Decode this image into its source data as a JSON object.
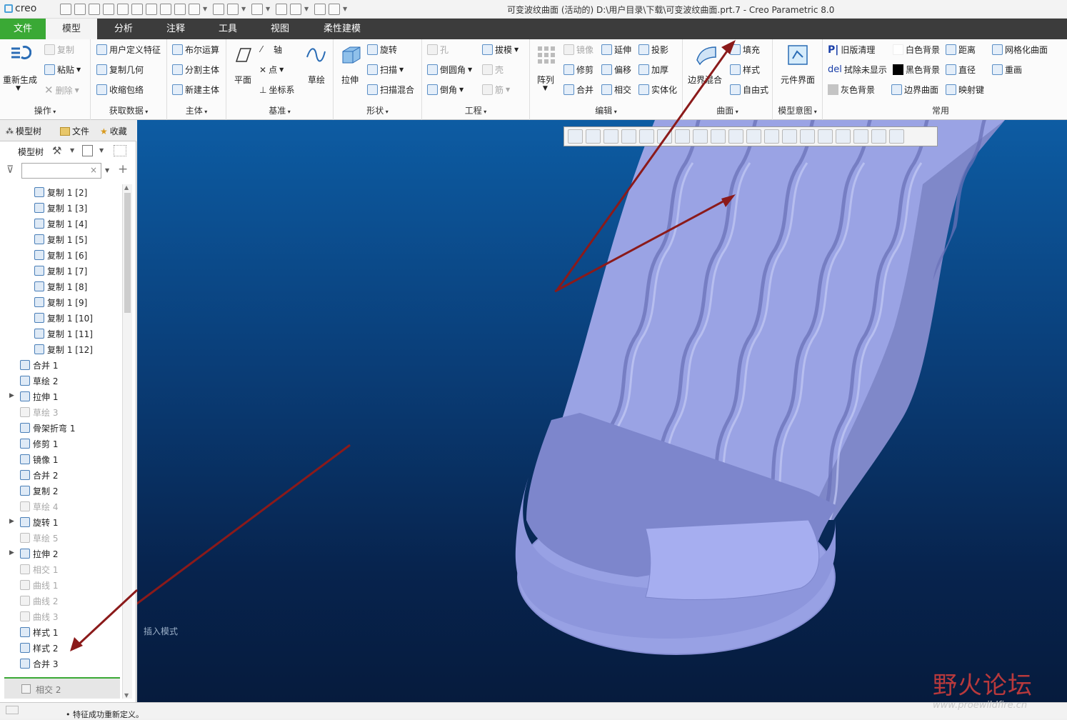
{
  "app": {
    "logo": "creo",
    "window_title": "可变波纹曲面 (活动的) D:\\用户目录\\下载\\可变波纹曲面.prt.7 - Creo Parametric 8.0"
  },
  "tabs": [
    "文件",
    "模型",
    "分析",
    "注释",
    "工具",
    "视图",
    "柔性建模"
  ],
  "ribbon": {
    "ops": {
      "label": "操作",
      "regen": "重新生成",
      "copy": "复制",
      "paste": "粘贴",
      "delete": "删除"
    },
    "getdata": {
      "label": "获取数据",
      "udf": "用户定义特征",
      "copygeom": "复制几何",
      "shrink": "收缩包络"
    },
    "body": {
      "label": "主体",
      "boolean": "布尔运算",
      "split": "分割主体",
      "newbody": "新建主体"
    },
    "datum": {
      "label": "基准",
      "plane": "平面",
      "axis": "轴",
      "point": "点",
      "csys": "坐标系",
      "sketch": "草绘"
    },
    "shape": {
      "label": "形状",
      "extrude": "拉伸",
      "revolve": "旋转",
      "sweep": "扫描",
      "sweepblend": "扫描混合"
    },
    "eng": {
      "label": "工程",
      "hole": "孔",
      "draft": "拔模",
      "round": "倒圆角",
      "shell": "壳",
      "chamfer": "倒角",
      "rib": "筋"
    },
    "edit": {
      "label": "编辑",
      "pattern": "阵列",
      "mirror": "镜像",
      "extend": "延伸",
      "project": "投影",
      "trim": "修剪",
      "offset": "偏移",
      "thicken": "加厚",
      "merge": "合并",
      "intersect": "相交",
      "solidify": "实体化"
    },
    "surf": {
      "label": "曲面",
      "boundary": "边界混合",
      "fill": "填充",
      "style": "样式",
      "freestyle": "自由式"
    },
    "intent": {
      "label": "模型意图",
      "comp": "元件界面"
    },
    "common": {
      "label": "常用",
      "oldclean": "旧版清理",
      "whitebg": "白色背景",
      "dist": "距离",
      "mesh": "网格化曲面",
      "erase": "拭除未显示",
      "blackbg": "黑色背景",
      "diam": "直径",
      "repaint": "重画",
      "greybg": "灰色背景",
      "bndsurf": "边界曲面",
      "mapkey": "映射键"
    }
  },
  "panel": {
    "tabs": [
      "模型树",
      "文件",
      "收藏"
    ],
    "tree_label": "模型树",
    "search_placeholder": ""
  },
  "tree": [
    {
      "label": "复制 1 [2]",
      "state": "active",
      "indent": 2,
      "expand": false
    },
    {
      "label": "复制 1 [3]",
      "state": "active",
      "indent": 2,
      "expand": false
    },
    {
      "label": "复制 1 [4]",
      "state": "active",
      "indent": 2,
      "expand": false
    },
    {
      "label": "复制 1 [5]",
      "state": "active",
      "indent": 2,
      "expand": false
    },
    {
      "label": "复制 1 [6]",
      "state": "active",
      "indent": 2,
      "expand": false
    },
    {
      "label": "复制 1 [7]",
      "state": "active",
      "indent": 2,
      "expand": false
    },
    {
      "label": "复制 1 [8]",
      "state": "active",
      "indent": 2,
      "expand": false
    },
    {
      "label": "复制 1 [9]",
      "state": "active",
      "indent": 2,
      "expand": false
    },
    {
      "label": "复制 1 [10]",
      "state": "active",
      "indent": 2,
      "expand": false
    },
    {
      "label": "复制 1 [11]",
      "state": "active",
      "indent": 2,
      "expand": false
    },
    {
      "label": "复制 1 [12]",
      "state": "active",
      "indent": 2,
      "expand": false
    },
    {
      "label": "合并 1",
      "state": "active",
      "indent": 1,
      "expand": false
    },
    {
      "label": "草绘 2",
      "state": "active",
      "indent": 1,
      "expand": false
    },
    {
      "label": "拉伸 1",
      "state": "active",
      "indent": 1,
      "expand": true
    },
    {
      "label": "草绘 3",
      "state": "suppressed",
      "indent": 1,
      "expand": false
    },
    {
      "label": "骨架折弯 1",
      "state": "active",
      "indent": 1,
      "expand": false
    },
    {
      "label": "修剪 1",
      "state": "active",
      "indent": 1,
      "expand": false
    },
    {
      "label": "镜像 1",
      "state": "active",
      "indent": 1,
      "expand": false
    },
    {
      "label": "合并 2",
      "state": "active",
      "indent": 1,
      "expand": false
    },
    {
      "label": "复制 2",
      "state": "active",
      "indent": 1,
      "expand": false
    },
    {
      "label": "草绘 4",
      "state": "suppressed",
      "indent": 1,
      "expand": false
    },
    {
      "label": "旋转 1",
      "state": "active",
      "indent": 1,
      "expand": true
    },
    {
      "label": "草绘 5",
      "state": "suppressed",
      "indent": 1,
      "expand": false
    },
    {
      "label": "拉伸 2",
      "state": "active",
      "indent": 1,
      "expand": true
    },
    {
      "label": "相交 1",
      "state": "suppressed",
      "indent": 1,
      "expand": false
    },
    {
      "label": "曲线 1",
      "state": "suppressed",
      "indent": 1,
      "expand": false
    },
    {
      "label": "曲线 2",
      "state": "suppressed",
      "indent": 1,
      "expand": false
    },
    {
      "label": "曲线 3",
      "state": "suppressed",
      "indent": 1,
      "expand": false
    },
    {
      "label": "样式 1",
      "state": "active",
      "indent": 1,
      "expand": false
    },
    {
      "label": "样式 2",
      "state": "active",
      "indent": 1,
      "expand": false
    },
    {
      "label": "合并 3",
      "state": "active",
      "indent": 1,
      "expand": false
    }
  ],
  "insert_after": "相交 2",
  "viewport": {
    "mode_text": "插入模式"
  },
  "status": {
    "message": "特征成功重新定义。"
  },
  "watermark": {
    "cn": "野火论坛",
    "url": "www.proewildfire.cn"
  },
  "colors": {
    "file_tab": "#3aa935",
    "arrow": "#8b1a1a",
    "surface": "#a2aaec"
  }
}
